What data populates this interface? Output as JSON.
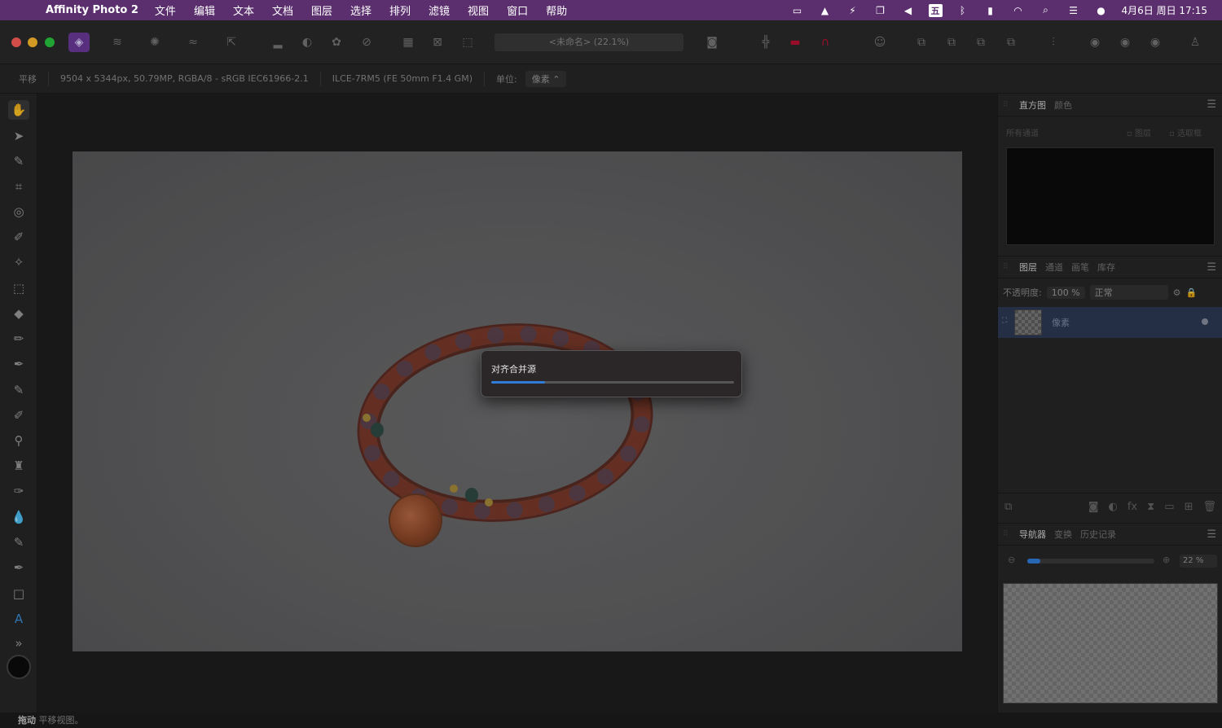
{
  "menubar": {
    "app_name": "Affinity Photo 2",
    "items": [
      "文件",
      "编辑",
      "文本",
      "文档",
      "图层",
      "选择",
      "排列",
      "滤镜",
      "视图",
      "窗口",
      "帮助"
    ],
    "ime": "五",
    "clock": "4月6日 周日  17:15"
  },
  "toolbar": {
    "doc_title": "<未命名> (22.1%)"
  },
  "contextbar": {
    "tool_name": "平移",
    "image_info": "9504 x 5344px, 50.79MP, RGBA/8 - sRGB IEC61966-2.1",
    "camera": "ILCE-7RM5 (FE 50mm F1.4 GM)",
    "unit_label": "单位:",
    "unit_value": "像素"
  },
  "progress": {
    "title": "对齐合并源",
    "fraction": 0.22
  },
  "panels": {
    "histogram_tabs": [
      "直方图",
      "颜色"
    ],
    "histogram_channel": "所有通道",
    "histogram_opt1": "图层",
    "histogram_opt2": "选取框",
    "layers_tabs": [
      "图层",
      "通道",
      "画笔",
      "库存"
    ],
    "opacity_label": "不透明度:",
    "opacity_value": "100 %",
    "blend_mode": "正常",
    "layer_name": "像素",
    "navigator_tabs": [
      "导航器",
      "变换",
      "历史记录"
    ],
    "zoom_value": "22 %",
    "zoom_fraction": 0.1
  },
  "statusbar": {
    "bold": "拖动",
    "text": "平移视图。"
  }
}
